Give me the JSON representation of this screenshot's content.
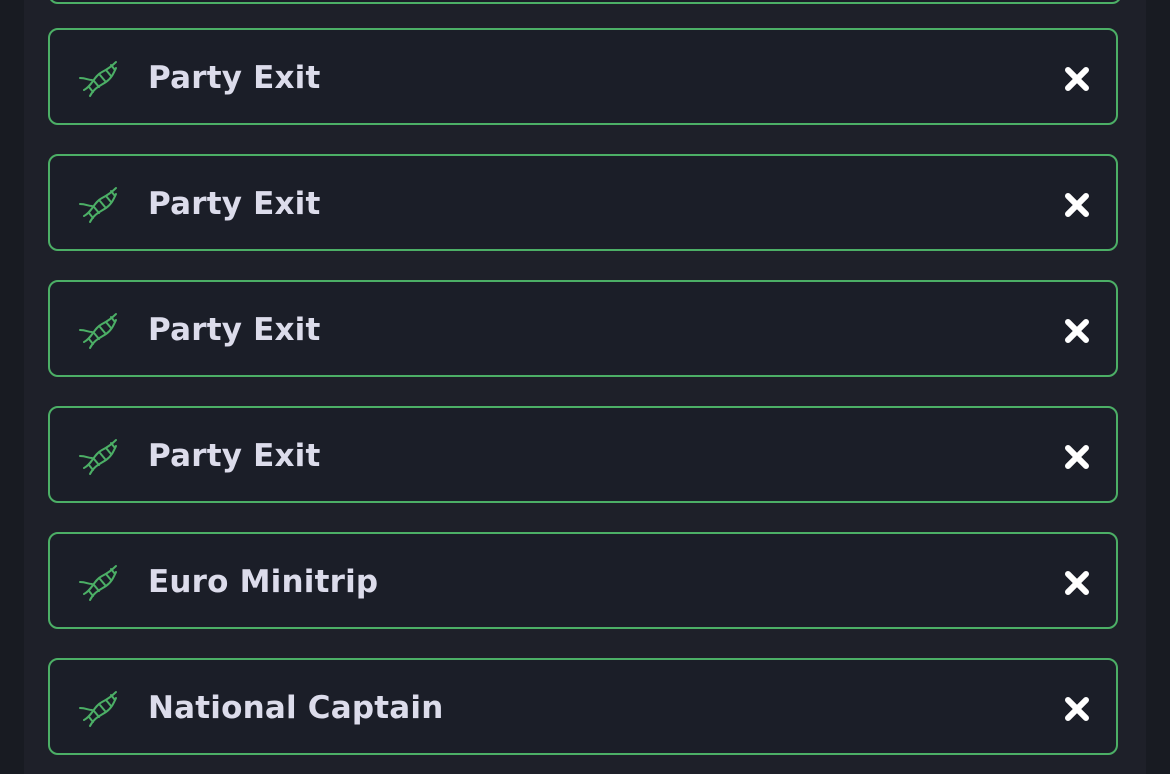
{
  "items": [
    {
      "label": "Party Exit"
    },
    {
      "label": "Party Exit"
    },
    {
      "label": "Party Exit"
    },
    {
      "label": "Party Exit"
    },
    {
      "label": "Euro Minitrip"
    },
    {
      "label": "National Captain"
    }
  ],
  "icons": {
    "item_icon": "dna-icon",
    "remove_icon": "close-icon"
  },
  "colors": {
    "border": "#4caf66",
    "item_background": "#1b1e28",
    "text": "#dcdceb",
    "icon_green": "#4caf66",
    "close": "#ffffff"
  }
}
